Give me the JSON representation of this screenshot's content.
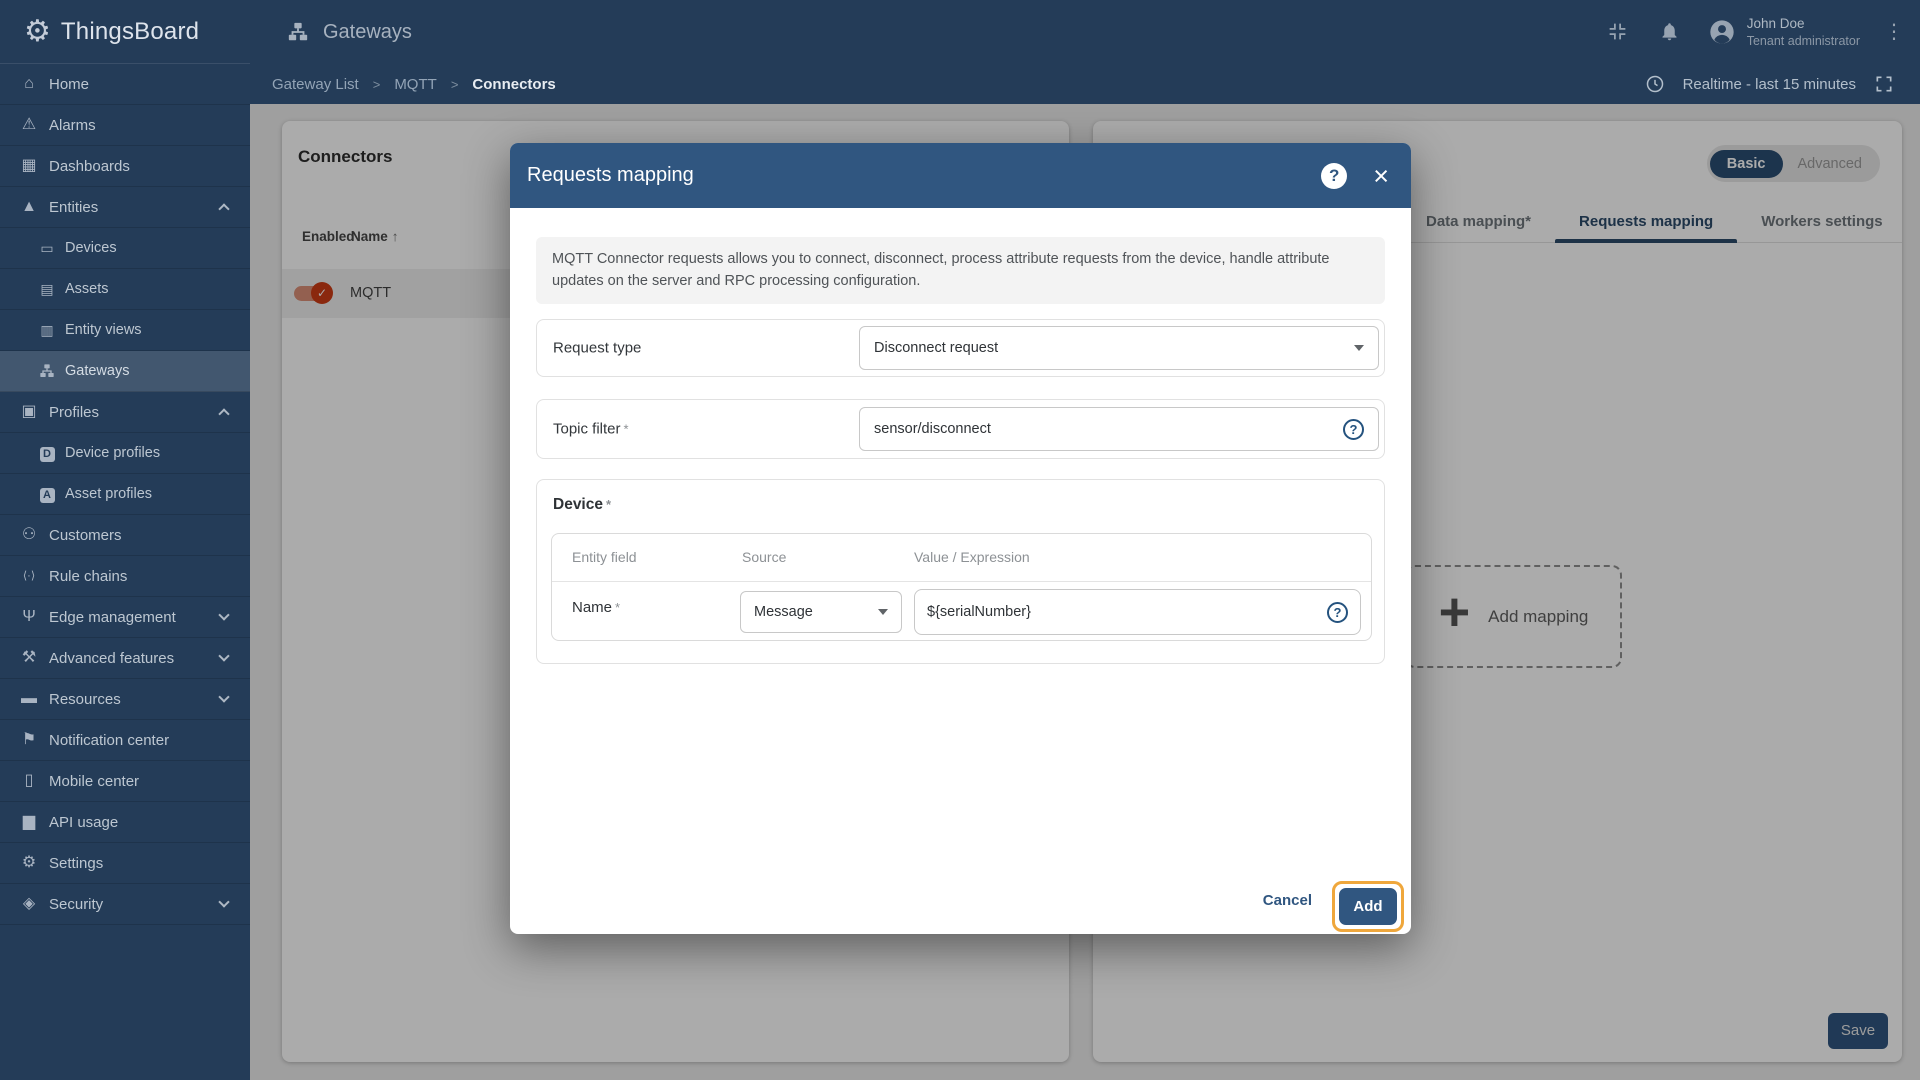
{
  "app": {
    "brand": "ThingsBoard",
    "page_title": "Gateways"
  },
  "header": {
    "user_name": "John Doe",
    "user_role": "Tenant administrator",
    "icons": [
      "collapse-icon",
      "notifications-bell-icon",
      "avatar",
      "kebab-menu-icon"
    ]
  },
  "breadcrumb": {
    "items": [
      "Gateway List",
      "MQTT",
      "Connectors"
    ],
    "separator": ">"
  },
  "timewindow": {
    "label": "Realtime - last 15 minutes",
    "icons": [
      "clock-icon",
      "fullscreen-icon"
    ]
  },
  "sidebar": {
    "items": [
      {
        "label": "Home",
        "icon": "home-icon"
      },
      {
        "label": "Alarms",
        "icon": "alarms-icon"
      },
      {
        "label": "Dashboards",
        "icon": "dashboards-icon"
      },
      {
        "label": "Entities",
        "icon": "entities-icon",
        "chevron": "up"
      },
      {
        "label": "Devices",
        "icon": "devices-icon",
        "sub": true
      },
      {
        "label": "Assets",
        "icon": "assets-icon",
        "sub": true
      },
      {
        "label": "Entity views",
        "icon": "entity-views-icon",
        "sub": true
      },
      {
        "label": "Gateways",
        "icon": "gateways-icon",
        "sub": true,
        "selected": true
      },
      {
        "label": "Profiles",
        "icon": "profiles-icon",
        "chevron": "up"
      },
      {
        "label": "Device profiles",
        "icon": "device-profiles-icon",
        "sub": true
      },
      {
        "label": "Asset profiles",
        "icon": "asset-profiles-icon",
        "sub": true
      },
      {
        "label": "Customers",
        "icon": "customers-icon"
      },
      {
        "label": "Rule chains",
        "icon": "rule-chains-icon"
      },
      {
        "label": "Edge management",
        "icon": "edge-management-icon",
        "chevron": "down"
      },
      {
        "label": "Advanced features",
        "icon": "advanced-features-icon",
        "chevron": "down"
      },
      {
        "label": "Resources",
        "icon": "resources-icon",
        "chevron": "down"
      },
      {
        "label": "Notification center",
        "icon": "notification-center-icon"
      },
      {
        "label": "Mobile center",
        "icon": "mobile-center-icon"
      },
      {
        "label": "API usage",
        "icon": "api-usage-icon"
      },
      {
        "label": "Settings",
        "icon": "settings-icon"
      },
      {
        "label": "Security",
        "icon": "security-icon",
        "chevron": "down"
      }
    ]
  },
  "connectors_panel": {
    "title": "Connectors",
    "col_enabled": "Enabled",
    "col_name": "Name",
    "sort_indicator": "↑",
    "rows": [
      {
        "name": "MQTT",
        "enabled": true
      }
    ]
  },
  "config_panel": {
    "mode_toggle": {
      "basic": "Basic",
      "advanced": "Advanced",
      "selected": "Basic"
    },
    "tabs": [
      {
        "label": "Data mapping*",
        "active": false
      },
      {
        "label": "Requests mapping",
        "active": true
      },
      {
        "label": "Workers settings",
        "active": false
      }
    ],
    "add_mapping_label": "Add mapping",
    "save_label": "Save"
  },
  "modal": {
    "title": "Requests mapping",
    "description": "MQTT Connector requests allows you to connect, disconnect, process attribute requests from the device, handle attribute updates on the server and RPC processing configuration.",
    "request_type": {
      "label": "Request type",
      "value": "Disconnect request"
    },
    "topic_filter": {
      "label": "Topic filter",
      "required_mark": "*",
      "value": "sensor/disconnect"
    },
    "device_section": {
      "label": "Device",
      "required_mark": "*",
      "columns": {
        "entity_field": "Entity field",
        "source": "Source",
        "value_expression": "Value / Expression"
      },
      "row": {
        "field": "Name",
        "required_mark": "*",
        "source_value": "Message",
        "expression_value": "${serialNumber}"
      }
    },
    "help_glyph": "?",
    "cancel_label": "Cancel",
    "add_label": "Add"
  },
  "colors": {
    "primary": "#305680",
    "sidebar_bg": "#243C58",
    "toggle_on": "#CE3D15",
    "attention_highlight": "#EFA73C"
  }
}
